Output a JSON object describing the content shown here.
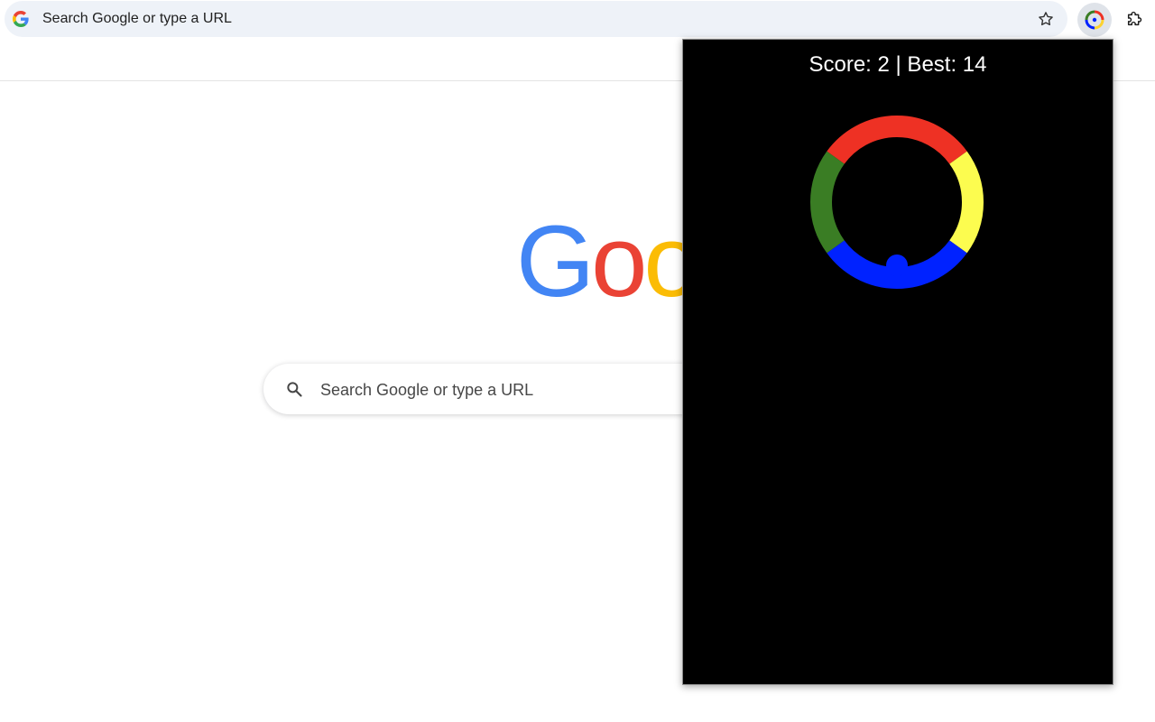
{
  "browser": {
    "omnibox_text": "Search Google or type a URL",
    "icons": {
      "site": "google-g-icon",
      "bookmark": "star-icon",
      "active_extension": "color-ring-extension-icon",
      "extensions_menu": "puzzle-piece-icon"
    }
  },
  "newtab": {
    "logo_text": "Goo",
    "search_placeholder": "Search Google or type a URL",
    "search_icon": "magnifier-icon"
  },
  "game_popup": {
    "score_label": "Score: 2 | Best: 14",
    "score": 2,
    "best": 14,
    "ring_colors": {
      "top": "#ee3124",
      "right": "#fcfc4f",
      "bottom": "#0022ff",
      "left": "#3a7d24"
    },
    "ball_color": "#0022ff",
    "background": "#000000"
  },
  "colors": {
    "google_blue": "#4285f4",
    "google_red": "#ea4335",
    "google_yellow": "#fbbc05",
    "google_green": "#34a853",
    "omnibox_bg": "#eef2f8"
  }
}
